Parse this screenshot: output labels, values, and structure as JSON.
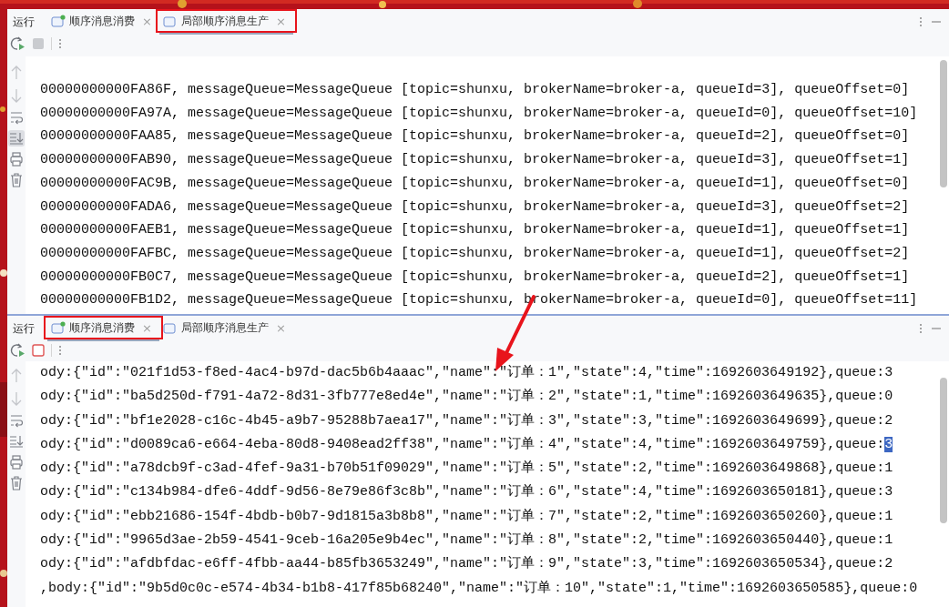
{
  "panels": [
    {
      "title": "运行",
      "stop_enabled": false,
      "scroll_to_end_on": true,
      "tabs": [
        {
          "label": "顺序消息消费",
          "running": true,
          "selected": false,
          "annotated": false,
          "close": "×"
        },
        {
          "label": "局部顺序消息生产",
          "running": false,
          "selected": true,
          "annotated": true,
          "close": "×"
        }
      ],
      "lines": [
        {
          "text": "00000000000FA86F, messageQueue=MessageQueue [topic=shunxu, brokerName=broker-a, queueId=3], queueOffset=0]"
        },
        {
          "text": "00000000000FA97A, messageQueue=MessageQueue [topic=shunxu, brokerName=broker-a, queueId=0], queueOffset=10]"
        },
        {
          "text": "00000000000FAA85, messageQueue=MessageQueue [topic=shunxu, brokerName=broker-a, queueId=2], queueOffset=0]"
        },
        {
          "text": "00000000000FAB90, messageQueue=MessageQueue [topic=shunxu, brokerName=broker-a, queueId=3], queueOffset=1]"
        },
        {
          "text": "00000000000FAC9B, messageQueue=MessageQueue [topic=shunxu, brokerName=broker-a, queueId=1], queueOffset=0]"
        },
        {
          "text": "00000000000FADA6, messageQueue=MessageQueue [topic=shunxu, brokerName=broker-a, queueId=3], queueOffset=2]"
        },
        {
          "text": "00000000000FAEB1, messageQueue=MessageQueue [topic=shunxu, brokerName=broker-a, queueId=1], queueOffset=1]"
        },
        {
          "text": "00000000000FAFBC, messageQueue=MessageQueue [topic=shunxu, brokerName=broker-a, queueId=1], queueOffset=2]"
        },
        {
          "text": "00000000000FB0C7, messageQueue=MessageQueue [topic=shunxu, brokerName=broker-a, queueId=2], queueOffset=1]"
        },
        {
          "text": "00000000000FB1D2, messageQueue=MessageQueue [topic=shunxu, brokerName=broker-a, queueId=0], queueOffset=11]"
        }
      ]
    },
    {
      "title": "运行",
      "stop_enabled": true,
      "scroll_to_end_on": false,
      "tabs": [
        {
          "label": "顺序消息消费",
          "running": true,
          "selected": true,
          "annotated": true,
          "close": "×"
        },
        {
          "label": "局部顺序消息生产",
          "running": false,
          "selected": false,
          "annotated": false,
          "close": "×"
        }
      ],
      "lines": [
        {
          "text": "ody:{\"id\":\"021f1d53-f8ed-4ac4-b97d-dac5b6b4aaac\",\"name\":\"订单：1\",\"state\":4,\"time\":1692603649192},queue:3"
        },
        {
          "text": "ody:{\"id\":\"ba5d250d-f791-4a72-8d31-3fb777e8ed4e\",\"name\":\"订单：2\",\"state\":1,\"time\":1692603649635},queue:0"
        },
        {
          "text": "ody:{\"id\":\"bf1e2028-c16c-4b45-a9b7-95288b7aea17\",\"name\":\"订单：3\",\"state\":3,\"time\":1692603649699},queue:2"
        },
        {
          "text": "ody:{\"id\":\"d0089ca6-e664-4eba-80d8-9408ead2ff38\",\"name\":\"订单：4\",\"state\":4,\"time\":1692603649759},queue:",
          "highlight": "3"
        },
        {
          "text": "ody:{\"id\":\"a78dcb9f-c3ad-4fef-9a31-b70b51f09029\",\"name\":\"订单：5\",\"state\":2,\"time\":1692603649868},queue:1"
        },
        {
          "text": "ody:{\"id\":\"c134b984-dfe6-4ddf-9d56-8e79e86f3c8b\",\"name\":\"订单：6\",\"state\":4,\"time\":1692603650181},queue:3"
        },
        {
          "text": "ody:{\"id\":\"ebb21686-154f-4bdb-b0b7-9d1815a3b8b8\",\"name\":\"订单：7\",\"state\":2,\"time\":1692603650260},queue:1"
        },
        {
          "text": "ody:{\"id\":\"9965d3ae-2b59-4541-9ceb-16a205e9b4ec\",\"name\":\"订单：8\",\"state\":2,\"time\":1692603650440},queue:1"
        },
        {
          "text": "ody:{\"id\":\"afdbfdac-e6ff-4fbb-aa44-b85fb3653249\",\"name\":\"订单：9\",\"state\":3,\"time\":1692603650534},queue:2"
        },
        {
          "text": ",body:{\"id\":\"9b5d0c0c-e574-4b34-b1b8-417f85b68240\",\"name\":\"订单：10\",\"state\":1,\"time\":1692603650585},queue:0"
        }
      ]
    }
  ]
}
